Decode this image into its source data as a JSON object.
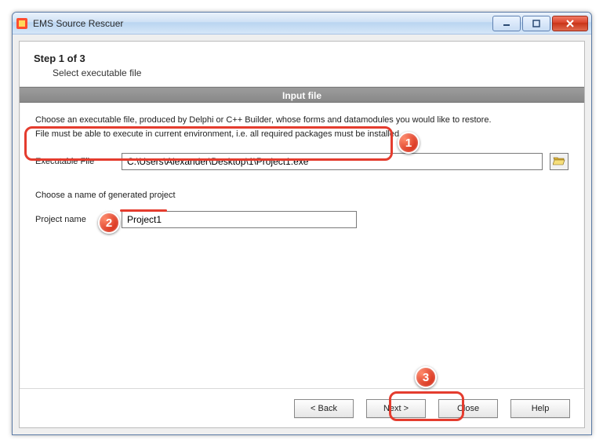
{
  "window": {
    "title": "EMS Source Rescuer"
  },
  "step": {
    "title": "Step 1 of 3",
    "subtitle": "Select executable file"
  },
  "section_bar": "Input file",
  "instructions": {
    "line1": "Choose an executable file, produced by  Delphi or C++ Builder, whose forms and datamodules you would like to restore.",
    "line2": "File must be able to execute in current environment, i.e. all required packages must be installed."
  },
  "fields": {
    "exe_label": "Executable File",
    "exe_value": "C:\\Users\\Alexander\\Desktop\\1\\Project1.exe",
    "proj_instruction": "Choose a name of generated project",
    "proj_label": "Project name",
    "proj_value": "Project1"
  },
  "buttons": {
    "back": "< Back",
    "next": "Next >",
    "close": "Close",
    "help": "Help"
  },
  "annotations": {
    "b1": "1",
    "b2": "2",
    "b3": "3"
  }
}
